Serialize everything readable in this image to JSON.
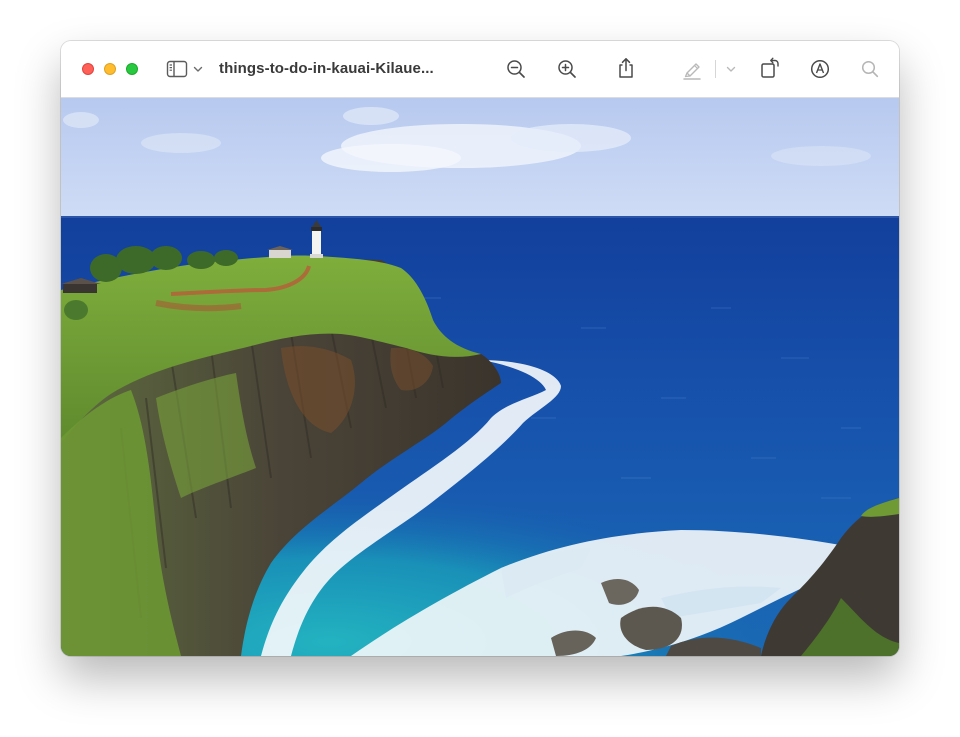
{
  "window": {
    "title": "things-to-do-in-kauai-Kilaue..."
  },
  "toolbar": {
    "sidebar_toggle_icon": "sidebar-icon",
    "sidebar_menu_icon": "chevron-down-icon",
    "zoom_out_icon": "zoom-out-icon",
    "zoom_in_icon": "zoom-in-icon",
    "share_icon": "share-icon",
    "markup_icon": "highlighter-pen-icon",
    "markup_menu_icon": "chevron-down-icon",
    "rotate_icon": "rotate-icon",
    "annotate_icon": "markup-circle-icon",
    "search_icon": "search-icon"
  },
  "image": {
    "subject": "Kilauea lighthouse on cliff above ocean",
    "colors": {
      "sky": "#c9d8f4",
      "ocean_deep": "#1548a8",
      "ocean_shallow": "#1a9ab8",
      "surf": "#ffffff",
      "grass": "#7fa83a",
      "cliff_rock": "#4c463c"
    }
  },
  "traffic_lights": {
    "close": "#fe5f57",
    "minimize": "#febc2e",
    "maximize": "#28c840"
  }
}
